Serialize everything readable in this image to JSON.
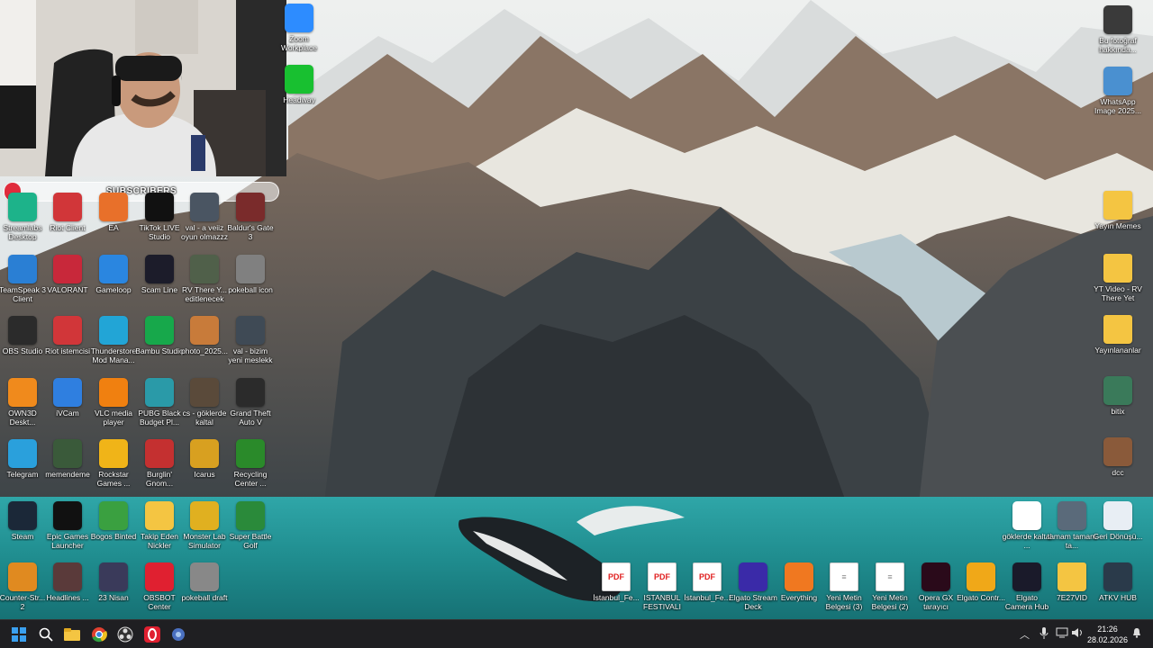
{
  "stream_overlay": {
    "subscriber_label": "SUBSCRIBERS",
    "subscriber_progress_percent": 6
  },
  "desktop_icons": [
    {
      "label": "Streamlabs Desktop",
      "icon": "streamlabs-icon",
      "color": "#1db38a"
    },
    {
      "label": "Riot Client",
      "icon": "riot-client-icon",
      "color": "#d13639"
    },
    {
      "label": "EA",
      "icon": "ea-icon",
      "color": "#e8702a"
    },
    {
      "label": "TikTok LIVE Studio",
      "icon": "tiktok-icon",
      "color": "#111111"
    },
    {
      "label": "val - a veiiz oyun olmazzz",
      "icon": "video-file-icon",
      "color": "#4a5562"
    },
    {
      "label": "Baldur's Gate 3",
      "icon": "baldurs-gate-icon",
      "color": "#7a2b2b"
    },
    {
      "label": "TeamSpeak 3 Client",
      "icon": "teamspeak-icon",
      "color": "#2a7fd4"
    },
    {
      "label": "VALORANT",
      "icon": "valorant-icon",
      "color": "#c8283a"
    },
    {
      "label": "Gameloop",
      "icon": "gameloop-icon",
      "color": "#2a86e0"
    },
    {
      "label": "Scam Line",
      "icon": "scam-line-icon",
      "color": "#1c1c2a"
    },
    {
      "label": "RV There Y... editlenecek",
      "icon": "video-file-icon",
      "color": "#50604a"
    },
    {
      "label": "pokeball icon",
      "icon": "image-file-icon",
      "color": "#808080"
    },
    {
      "label": "OBS Studio",
      "icon": "obs-icon",
      "color": "#2b2b2b"
    },
    {
      "label": "Riot istemcisi",
      "icon": "riot-client-icon",
      "color": "#d13639"
    },
    {
      "label": "Thunderstore Mod Mana...",
      "icon": "thunderstore-icon",
      "color": "#22a5d6"
    },
    {
      "label": "Bambu Studio",
      "icon": "bambu-icon",
      "color": "#17a84b"
    },
    {
      "label": "photo_2025...",
      "icon": "image-file-icon",
      "color": "#c87b3a"
    },
    {
      "label": "val - bizim yeni meslekk",
      "icon": "video-file-icon",
      "color": "#3f4a55"
    },
    {
      "label": "OWN3D Deskt...",
      "icon": "own3d-icon",
      "color": "#f08a1c"
    },
    {
      "label": "iVCam",
      "icon": "ivcam-icon",
      "color": "#2f7fe0"
    },
    {
      "label": "VLC media player",
      "icon": "vlc-icon",
      "color": "#f08010"
    },
    {
      "label": "PUBG Black Budget Pl...",
      "icon": "pubg-icon",
      "color": "#2a9aa8"
    },
    {
      "label": "cs - göklerde kaltal",
      "icon": "video-file-icon",
      "color": "#5a4a3a"
    },
    {
      "label": "Grand Theft Auto V",
      "icon": "gta-icon",
      "color": "#2b2b2b"
    },
    {
      "label": "Telegram",
      "icon": "telegram-icon",
      "color": "#2aa0dc"
    },
    {
      "label": "memendeme",
      "icon": "memendeme-icon",
      "color": "#3a5a3a"
    },
    {
      "label": "Rockstar Games ...",
      "icon": "rockstar-icon",
      "color": "#f0b418"
    },
    {
      "label": "Burglin' Gnom...",
      "icon": "burglin-gnomes-icon",
      "color": "#c43030"
    },
    {
      "label": "Icarus",
      "icon": "icarus-icon",
      "color": "#d8a020"
    },
    {
      "label": "Recycling Center ...",
      "icon": "recycling-center-icon",
      "color": "#2a8a2a"
    },
    {
      "label": "Steam",
      "icon": "steam-icon",
      "color": "#1b2838"
    },
    {
      "label": "Epic Games Launcher",
      "icon": "epic-games-icon",
      "color": "#111111"
    },
    {
      "label": "Bogos Binted",
      "icon": "bogos-binted-icon",
      "color": "#3aa040"
    },
    {
      "label": "Takip Eden Nickler",
      "icon": "text-file-icon",
      "color": "#f4c542"
    },
    {
      "label": "Monster Lab Simulator",
      "icon": "monster-lab-icon",
      "color": "#e0b020"
    },
    {
      "label": "Super Battle Golf",
      "icon": "super-battle-golf-icon",
      "color": "#2a8a3a"
    },
    {
      "label": "Counter-Str... 2",
      "icon": "counter-strike-icon",
      "color": "#e08a20"
    },
    {
      "label": "Headlines ...",
      "icon": "headlines-icon",
      "color": "#5a3a3a"
    },
    {
      "label": "23 Nisan",
      "icon": "image-file-icon",
      "color": "#3a3a5a"
    },
    {
      "label": "OBSBOT Center",
      "icon": "obsbot-icon",
      "color": "#e02030"
    },
    {
      "label": "pokeball draft",
      "icon": "image-file-icon",
      "color": "#888888"
    }
  ],
  "top_icons": [
    {
      "label": "Zoom Workplace",
      "icon": "zoom-icon",
      "color": "#2d8cff"
    },
    {
      "label": "Headway",
      "icon": "headway-icon",
      "color": "#18c030"
    }
  ],
  "right_icons": [
    {
      "label": "Bu fotoğraf hakkında...",
      "icon": "camera-lens-icon",
      "color": "#3a3a3a"
    },
    {
      "label": "WhatsApp Image 2025...",
      "icon": "image-file-icon",
      "color": "#4a90d0"
    },
    {
      "label": "Yayın Memes",
      "icon": "folder-icon",
      "color": "#f4c542"
    },
    {
      "label": "YT Video - RV There Yet",
      "icon": "folder-icon",
      "color": "#f4c542"
    },
    {
      "label": "Yayınlananlar",
      "icon": "folder-icon",
      "color": "#f4c542"
    },
    {
      "label": "bitix",
      "icon": "image-file-icon",
      "color": "#3a7a5a"
    },
    {
      "label": "dcc",
      "icon": "image-file-icon",
      "color": "#8a5a3a"
    }
  ],
  "bottom_icons": [
    {
      "label": "göklerde kaltal ...",
      "icon": "video-file-icon",
      "color": "#ffffff"
    },
    {
      "label": "tamam tamam ta...",
      "icon": "video-file-icon",
      "color": "#5a6a7a"
    },
    {
      "label": "Geri Dönüşü...",
      "icon": "recycle-bin-icon",
      "color": "#e8eef4"
    }
  ],
  "bottom_row_icons": [
    {
      "label": "İstanbul_Fe...",
      "icon": "pdf-icon",
      "type": "pdf"
    },
    {
      "label": "ISTANBUL FESTIVALI 3...",
      "icon": "pdf-icon",
      "type": "pdf"
    },
    {
      "label": "İstanbul_Fe...",
      "icon": "pdf-icon",
      "type": "pdf"
    },
    {
      "label": "Elgato Stream Deck",
      "icon": "stream-deck-icon",
      "color": "#3a2aa8"
    },
    {
      "label": "Everything",
      "icon": "everything-icon",
      "color": "#f07820"
    },
    {
      "label": "Yeni Metin Belgesi (3)",
      "icon": "text-file-icon",
      "type": "doc"
    },
    {
      "label": "Yeni Metin Belgesi (2)",
      "icon": "text-file-icon",
      "type": "doc"
    },
    {
      "label": "Opera GX tarayıcı",
      "icon": "opera-gx-icon",
      "color": "#2a0a1a"
    },
    {
      "label": "Elgato Contr...",
      "icon": "elgato-control-icon",
      "color": "#f0a818"
    },
    {
      "label": "Elgato Camera Hub",
      "icon": "elgato-camera-hub-icon",
      "color": "#1a1a2a"
    },
    {
      "label": "7E27VID",
      "icon": "folder-icon",
      "color": "#f4c542"
    },
    {
      "label": "ATKV HUB",
      "icon": "atkv-hub-icon",
      "color": "#2a3a4a"
    }
  ],
  "taskbar": {
    "pinned": [
      {
        "name": "start-button",
        "icon": "windows-icon"
      },
      {
        "name": "search-button",
        "icon": "search-icon"
      },
      {
        "name": "file-explorer-button",
        "icon": "folder-icon"
      },
      {
        "name": "chrome-button",
        "icon": "chrome-icon"
      },
      {
        "name": "obs-taskbar-button",
        "icon": "obs-icon"
      },
      {
        "name": "opera-taskbar-button",
        "icon": "opera-icon"
      },
      {
        "name": "app-taskbar-button",
        "icon": "app-icon"
      }
    ],
    "time": "21:26",
    "date": "28.02.2026"
  }
}
